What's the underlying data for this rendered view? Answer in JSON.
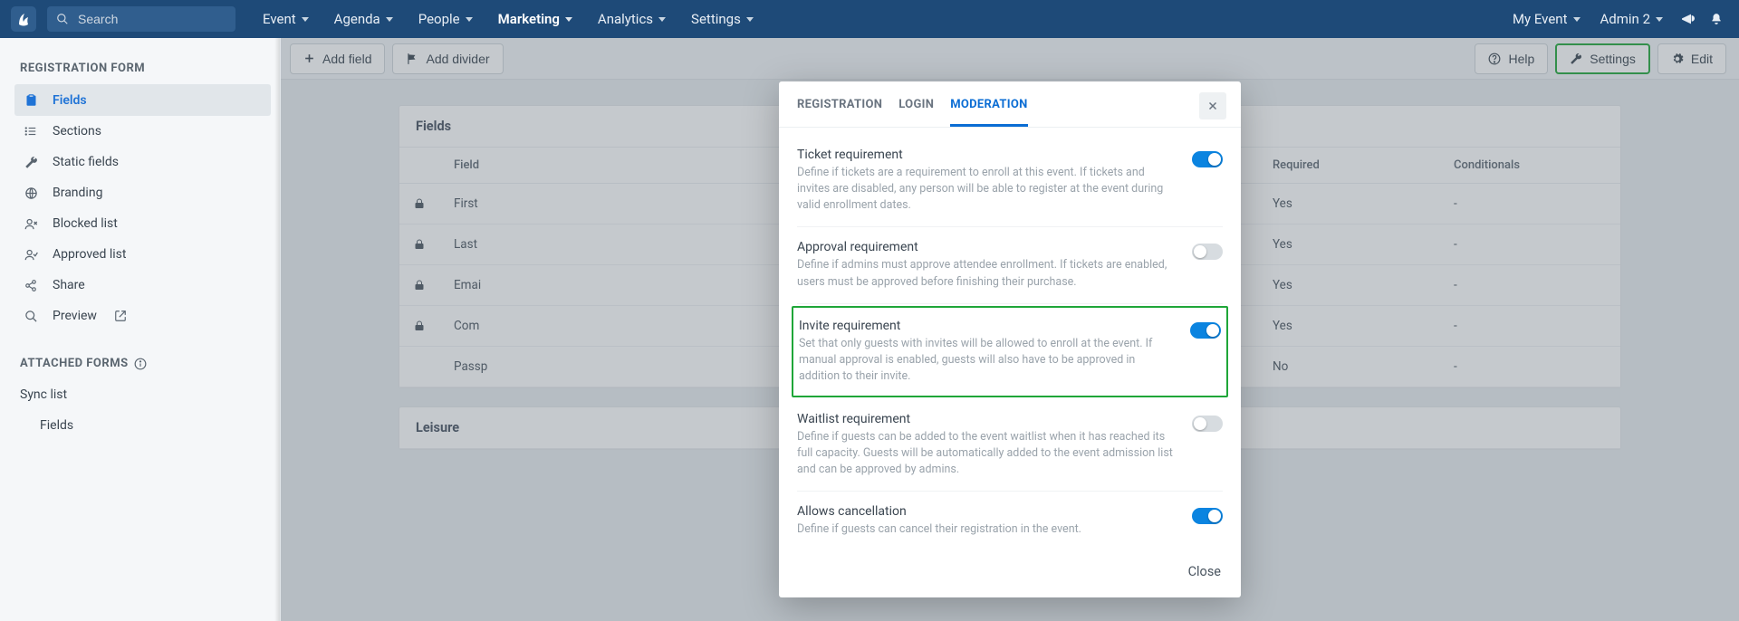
{
  "topnav": {
    "search_placeholder": "Search",
    "menus": [
      "Event",
      "Agenda",
      "People",
      "Marketing",
      "Analytics",
      "Settings"
    ],
    "active_menu_index": 3,
    "right": {
      "event_label": "My Event",
      "user_label": "Admin 2"
    }
  },
  "sidebar": {
    "heading": "REGISTRATION FORM",
    "items": [
      {
        "label": "Fields",
        "icon": "clipboard",
        "active": true
      },
      {
        "label": "Sections",
        "icon": "list"
      },
      {
        "label": "Static fields",
        "icon": "wrench"
      },
      {
        "label": "Branding",
        "icon": "globe"
      },
      {
        "label": "Blocked list",
        "icon": "user-x"
      },
      {
        "label": "Approved list",
        "icon": "user-check"
      },
      {
        "label": "Share",
        "icon": "share"
      },
      {
        "label": "Preview",
        "icon": "search",
        "external": true
      }
    ],
    "attached_heading": "ATTACHED FORMS",
    "sync_label": "Sync list",
    "sync_child": "Fields"
  },
  "toolbar": {
    "add_field": "Add field",
    "add_divider": "Add divider",
    "help": "Help",
    "settings": "Settings",
    "edit": "Edit"
  },
  "fields_card": {
    "title": "Fields",
    "columns": {
      "field": "Field",
      "required": "Required",
      "conditionals": "Conditionals"
    },
    "rows": [
      {
        "locked": true,
        "field": "First",
        "required": "Yes",
        "conditionals": "-"
      },
      {
        "locked": true,
        "field": "Last",
        "required": "Yes",
        "conditionals": "-"
      },
      {
        "locked": true,
        "field": "Emai",
        "required": "Yes",
        "conditionals": "-"
      },
      {
        "locked": true,
        "field": "Com",
        "required": "Yes",
        "conditionals": "-"
      },
      {
        "locked": false,
        "field": "Passp",
        "required": "No",
        "conditionals": "-"
      }
    ]
  },
  "leisure_card": {
    "title": "Leisure"
  },
  "modal": {
    "tabs": [
      "REGISTRATION",
      "LOGIN",
      "MODERATION"
    ],
    "active_tab_index": 2,
    "settings": [
      {
        "title": "Ticket requirement",
        "desc": "Define if tickets are a requirement to enroll at this event. If tickets and invites are disabled, any person will be able to register at the event during valid enrollment dates.",
        "on": true
      },
      {
        "title": "Approval requirement",
        "desc": "Define if admins must approve attendee enrollment. If tickets are enabled, users must be approved before finishing their purchase.",
        "on": false
      },
      {
        "title": "Invite requirement",
        "desc": "Set that only guests with invites will be allowed to enroll at the event. If manual approval is enabled, guests will also have to be approved in addition to their invite.",
        "on": true,
        "highlight": true
      },
      {
        "title": "Waitlist requirement",
        "desc": "Define if guests can be added to the event waitlist when it has reached its full capacity. Guests will be automatically added to the event admission list and can be approved by admins.",
        "on": false
      },
      {
        "title": "Allows cancellation",
        "desc": "Define if guests can cancel their registration in the event.",
        "on": true
      }
    ],
    "close_label": "Close"
  }
}
